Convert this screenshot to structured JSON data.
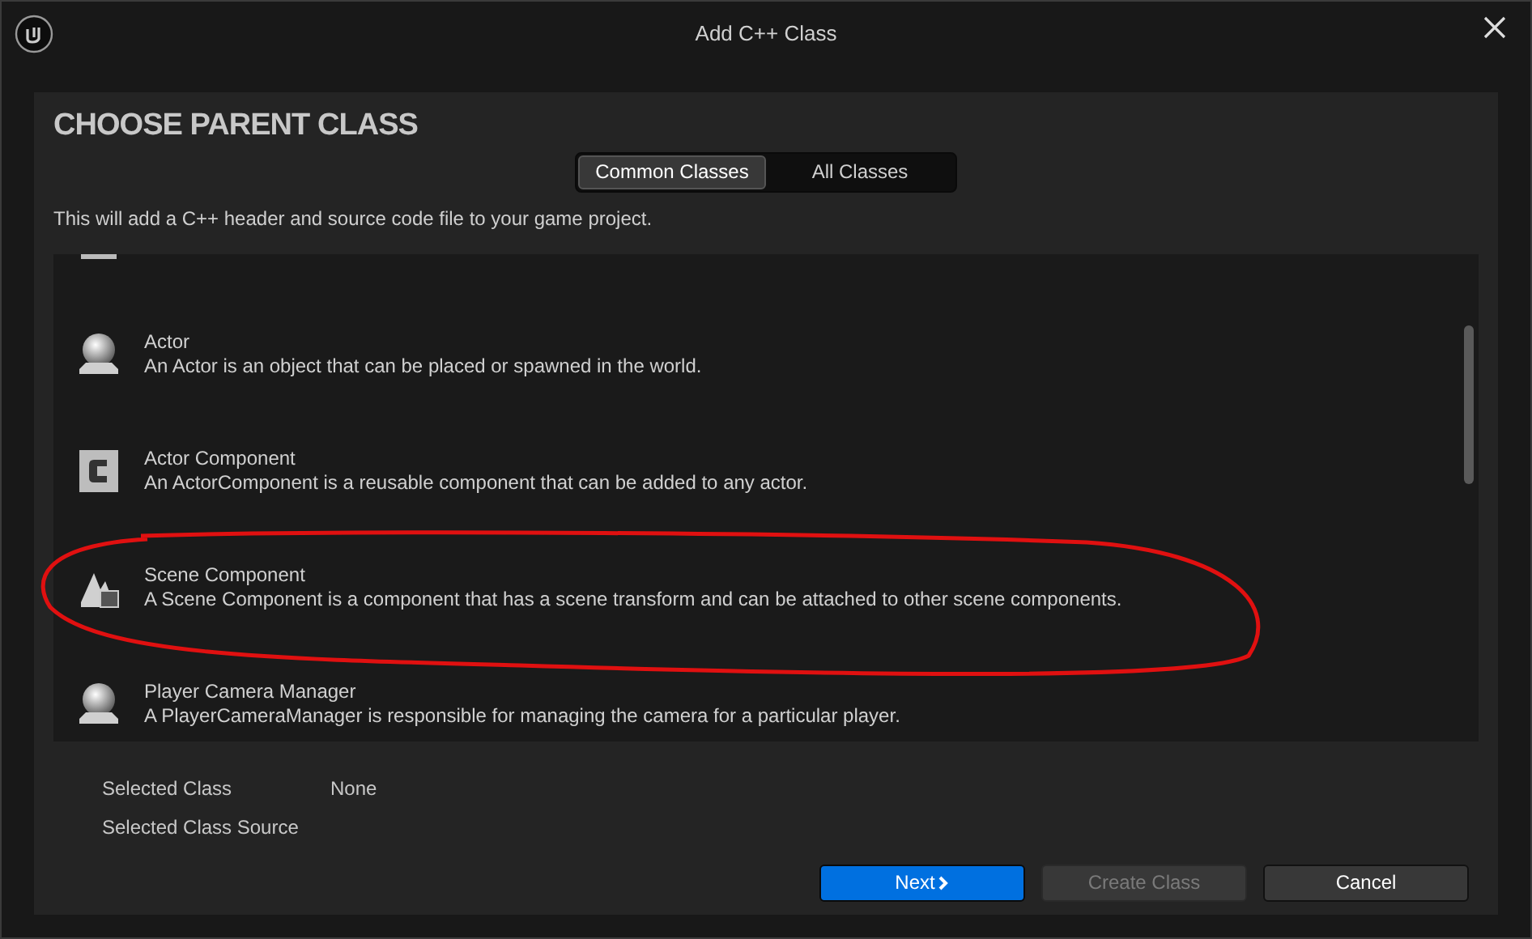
{
  "window": {
    "title": "Add C++ Class"
  },
  "heading": "CHOOSE PARENT CLASS",
  "tabs": [
    {
      "label": "Common Classes",
      "selected": true
    },
    {
      "label": "All Classes",
      "selected": false
    }
  ],
  "description": "This will add a C++ header and source code file to your game project.",
  "classes": [
    {
      "kind": "sphere",
      "name": "Actor",
      "description": "An Actor is an object that can be placed or spawned in the world."
    },
    {
      "kind": "component",
      "name": "Actor Component",
      "description": "An ActorComponent is a reusable component that can be added to any actor."
    },
    {
      "kind": "scene",
      "name": "Scene Component",
      "description": "A Scene Component is a component that has a scene transform and can be attached to other scene components."
    },
    {
      "kind": "sphere",
      "name": "Player Camera Manager",
      "description": "A PlayerCameraManager is responsible for managing the camera for a particular player."
    }
  ],
  "details": [
    {
      "label": "Selected Class",
      "value": "None"
    },
    {
      "label": "Selected Class Source"
    }
  ],
  "buttons": [
    {
      "label": "Next",
      "kind": "primary",
      "disabled": false
    },
    {
      "label": "Create Class",
      "kind": "default",
      "disabled": true
    },
    {
      "label": "Cancel",
      "kind": "default",
      "disabled": false
    }
  ]
}
